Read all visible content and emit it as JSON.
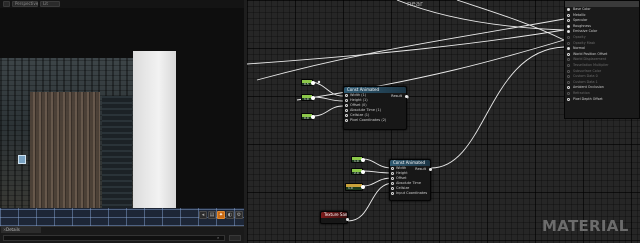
{
  "viewport": {
    "toolbar": [
      "",
      "Perspective",
      "Lit"
    ],
    "controls": [
      "◂",
      "▤",
      "✦",
      "◐",
      "⚙"
    ]
  },
  "details": {
    "tab_label": "Details",
    "close_glyph": "×",
    "search_placeholder": "",
    "search_icon_glyph": "⌕"
  },
  "graph": {
    "header_label": "near",
    "watermark": "MATERIAL",
    "result_node": {
      "title": "",
      "pins": [
        {
          "label": "Base Color",
          "filled": true,
          "muted": false
        },
        {
          "label": "Metallic",
          "filled": false,
          "muted": false
        },
        {
          "label": "Specular",
          "filled": false,
          "muted": false
        },
        {
          "label": "Roughness",
          "filled": true,
          "muted": false
        },
        {
          "label": "Emissive Color",
          "filled": true,
          "muted": false
        },
        {
          "label": "Opacity",
          "filled": false,
          "muted": true
        },
        {
          "label": "Opacity Mask",
          "filled": false,
          "muted": true
        },
        {
          "label": "Normal",
          "filled": true,
          "muted": false
        },
        {
          "label": "World Position Offset",
          "filled": false,
          "muted": false
        },
        {
          "label": "World Displacement",
          "filled": false,
          "muted": true
        },
        {
          "label": "Tessellation Multiplier",
          "filled": false,
          "muted": true
        },
        {
          "label": "Subsurface Color",
          "filled": false,
          "muted": true
        },
        {
          "label": "Custom Data 0",
          "filled": false,
          "muted": true
        },
        {
          "label": "Custom Data 1",
          "filled": false,
          "muted": true
        },
        {
          "label": "Ambient Occlusion",
          "filled": false,
          "muted": false
        },
        {
          "label": "Refraction",
          "filled": false,
          "muted": true
        },
        {
          "label": "Pixel Depth Offset",
          "filled": false,
          "muted": false
        }
      ]
    },
    "node_top": {
      "title": "Const Animated",
      "output_label": "Result",
      "pins": [
        "Width (1)",
        "Height (1)",
        "Offset (0)",
        "Absolute Time (1)",
        "Cellsize (1)",
        "Pixel Coordinates (2)"
      ]
    },
    "node_mid": {
      "title": "Const Animated",
      "output_label": "Result",
      "pins": [
        "Width",
        "Height",
        "Offset",
        "Absolute Time",
        "Cellsize",
        "Input Coordinates"
      ]
    },
    "node_param": {
      "title": "Texture Sample Param"
    },
    "constants": [
      {
        "value": "0.5",
        "amber": false
      },
      {
        "value": "1.0",
        "amber": false
      },
      {
        "value": "0.0",
        "amber": false
      },
      {
        "value": "1.0",
        "amber": false
      },
      {
        "value": "2.0",
        "amber": false
      },
      {
        "value": "1.0",
        "amber": true
      }
    ]
  }
}
